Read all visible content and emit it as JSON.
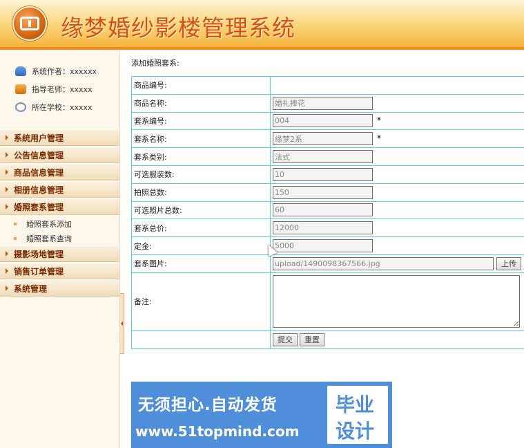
{
  "header": {
    "title": "缘梦婚纱影楼管理系统",
    "logo_icon": "double-square-logo-icon"
  },
  "sidebar": {
    "info": [
      {
        "icon": "people-icon",
        "label": "系统作者：xxxxxx"
      },
      {
        "icon": "teacher-icon",
        "label": "指导老师：xxxxx"
      },
      {
        "icon": "school-icon",
        "label": "所在学校：xxxxx"
      }
    ],
    "menu": [
      {
        "label": "系统用户管理"
      },
      {
        "label": "公告信息管理"
      },
      {
        "label": "商品信息管理"
      },
      {
        "label": "相册信息管理"
      },
      {
        "label": "婚照套系管理"
      },
      {
        "label": "摄影场地管理"
      },
      {
        "label": "销售订单管理"
      },
      {
        "label": "系统管理"
      }
    ],
    "sub_items": [
      {
        "label": "婚照套系添加"
      },
      {
        "label": "婚照套系查询"
      }
    ]
  },
  "form": {
    "title": "添加婚照套系:",
    "rows": [
      {
        "label": "商品编号:",
        "value": ""
      },
      {
        "label": "商品名称:",
        "value": "婚礼捧花"
      },
      {
        "label": "套系编号:",
        "value": "004",
        "required": "*"
      },
      {
        "label": "套系名称:",
        "value": "缘梦2系",
        "required": "*"
      },
      {
        "label": "套系类别:",
        "value": "法式"
      },
      {
        "label": "可选服装数:",
        "value": "10"
      },
      {
        "label": "拍照总数:",
        "value": "150"
      },
      {
        "label": "可选照片总数:",
        "value": "60"
      },
      {
        "label": "套系总价:",
        "value": "12000"
      },
      {
        "label": "定金:",
        "value": "5000"
      },
      {
        "label": "套系图片:",
        "value": "upload/1490098367566.jpg"
      },
      {
        "label": "备注:",
        "value": ""
      }
    ],
    "upload_label": "上传",
    "submit_label": "提交",
    "reset_label": "重置"
  },
  "ad": {
    "line1": "无须担心.自动发货",
    "line2": "www.51topmind.com",
    "badge_1": "毕业",
    "badge_2": "设计"
  },
  "colors": {
    "title": "#d9500e",
    "header_orange": "#f6b33a",
    "menu_text": "#7a2a00",
    "table_border": "#5ad3e0",
    "ad_blue": "#4f8ed8"
  }
}
